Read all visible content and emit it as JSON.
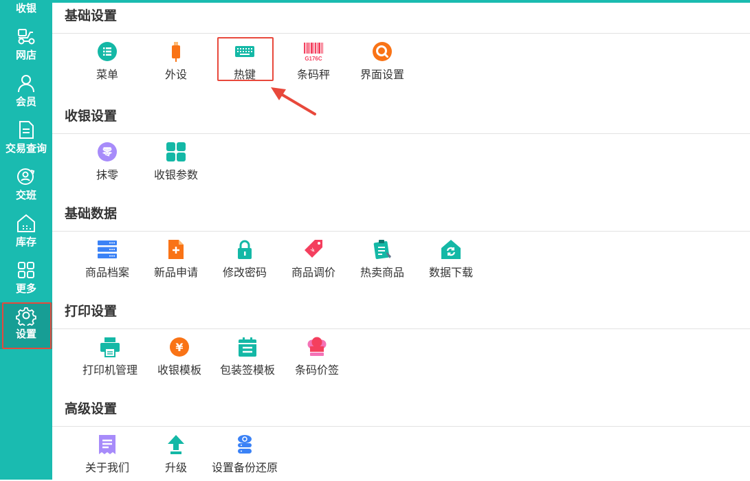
{
  "sidebar": {
    "top_label": "收银",
    "items": [
      {
        "label": "网店",
        "icon": "delivery-scooter-icon"
      },
      {
        "label": "会员",
        "icon": "person-icon"
      },
      {
        "label": "交易查询",
        "icon": "document-icon"
      },
      {
        "label": "交班",
        "icon": "user-shift-icon"
      },
      {
        "label": "库存",
        "icon": "warehouse-icon"
      },
      {
        "label": "更多",
        "icon": "grid-icon"
      },
      {
        "label": "设置",
        "icon": "gear-icon",
        "active": true
      }
    ]
  },
  "sections": [
    {
      "title": "基础设置",
      "items": [
        {
          "label": "菜单",
          "icon": "menu-list-icon",
          "color": "#14b8a6"
        },
        {
          "label": "外设",
          "icon": "usb-device-icon",
          "color": "#f97316"
        },
        {
          "label": "热键",
          "icon": "keyboard-icon",
          "color": "#14b8a6",
          "highlighted": true
        },
        {
          "label": "条码秤",
          "icon": "barcode-icon",
          "color": "#f43f5e",
          "icon_text": "G176C"
        },
        {
          "label": "界面设置",
          "icon": "search-circle-icon",
          "color": "#f97316"
        }
      ]
    },
    {
      "title": "收银设置",
      "items": [
        {
          "label": "抹零",
          "icon": "zero-badge-icon",
          "color": "#a78bfa",
          "icon_text": "零"
        },
        {
          "label": "收银参数",
          "icon": "four-squares-icon",
          "color": "#14b8a6"
        }
      ]
    },
    {
      "title": "基础数据",
      "items": [
        {
          "label": "商品档案",
          "icon": "server-stack-icon",
          "color": "#3b82f6"
        },
        {
          "label": "新品申请",
          "icon": "file-plus-icon",
          "color": "#f97316"
        },
        {
          "label": "修改密码",
          "icon": "lock-icon",
          "color": "#14b8a6"
        },
        {
          "label": "商品调价",
          "icon": "price-tag-icon",
          "color": "#f43f5e"
        },
        {
          "label": "热卖商品",
          "icon": "clipboard-icon",
          "color": "#14b8a6"
        },
        {
          "label": "数据下载",
          "icon": "refresh-house-icon",
          "color": "#14b8a6"
        }
      ]
    },
    {
      "title": "打印设置",
      "items": [
        {
          "label": "打印机管理",
          "icon": "printer-icon",
          "color": "#14b8a6"
        },
        {
          "label": "收银模板",
          "icon": "yen-circle-icon",
          "color": "#f97316",
          "icon_text": "¥"
        },
        {
          "label": "包装签模板",
          "icon": "calendar-list-icon",
          "color": "#14b8a6"
        },
        {
          "label": "条码价签",
          "icon": "chef-hat-icon",
          "color": "#f43f5e"
        }
      ]
    },
    {
      "title": "高级设置",
      "items": [
        {
          "label": "关于我们",
          "icon": "receipt-icon",
          "color": "#a78bfa"
        },
        {
          "label": "升级",
          "icon": "upgrade-arrow-icon",
          "color": "#14b8a6"
        },
        {
          "label": "设置备份还原",
          "icon": "cloud-database-icon",
          "color": "#3b82f6"
        }
      ]
    }
  ],
  "annotation": {
    "arrow_color": "#e8483b"
  }
}
